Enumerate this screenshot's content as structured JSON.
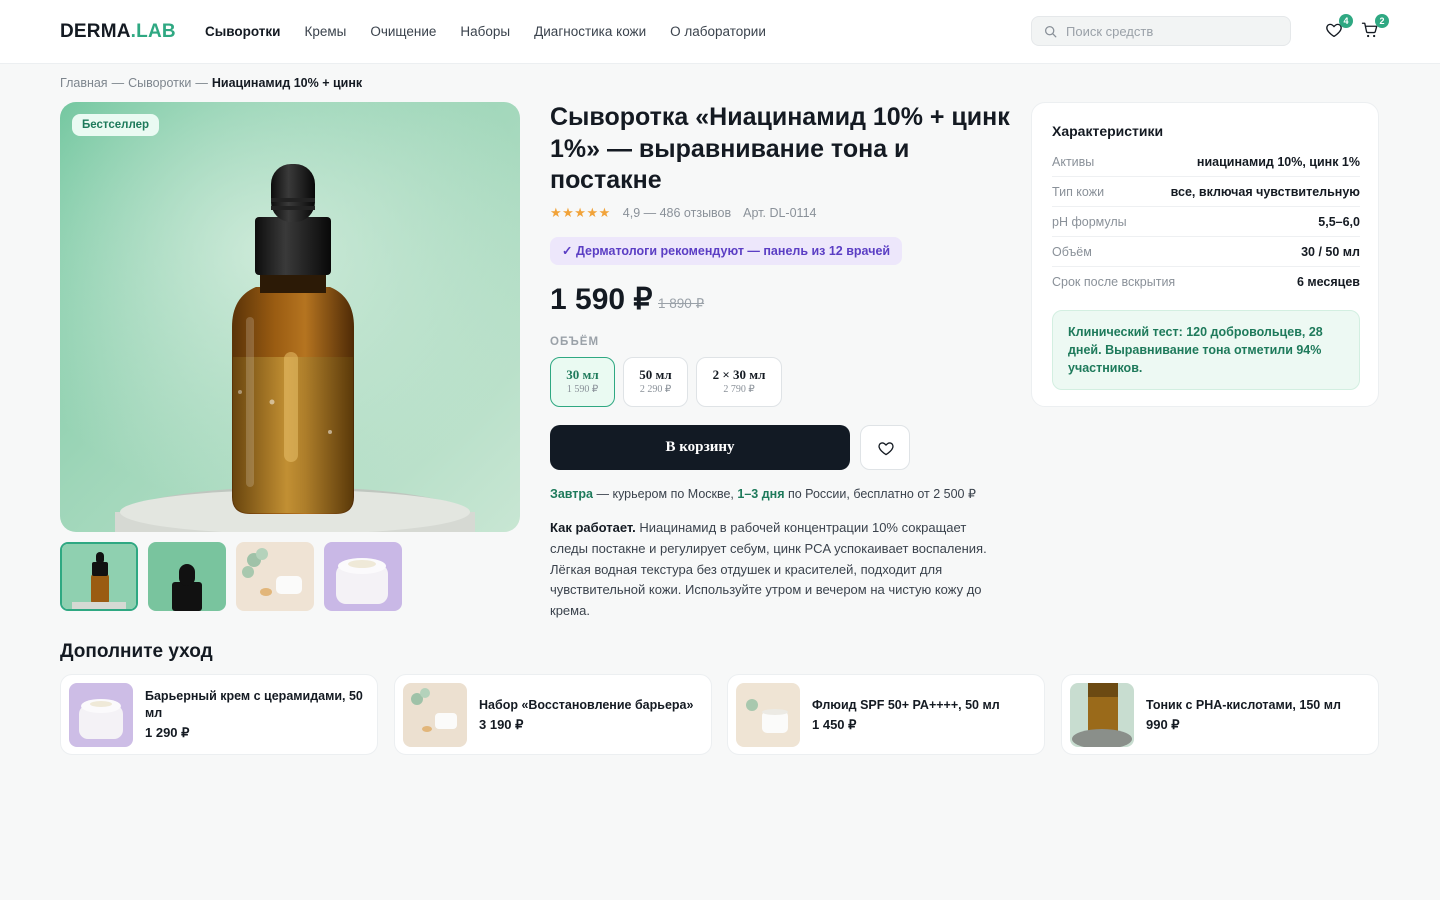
{
  "header": {
    "logo_main": "DERMA",
    "logo_dot": ".",
    "logo_accent": "LAB",
    "nav": [
      "Сыворотки",
      "Кремы",
      "Очищение",
      "Наборы",
      "Диагностика кожи",
      "О лаборатории"
    ],
    "active_nav": "Сыворотки",
    "search_placeholder": "Поиск средств",
    "wishlist_count": "4",
    "cart_count": "2"
  },
  "breadcrumb": {
    "items": [
      "Главная",
      "Сыворотки"
    ],
    "separator": "—",
    "current": "Ниацинамид 10% + цинк"
  },
  "gallery": {
    "badge": "Бестселлер",
    "thumbnails": [
      "dropper-bottle-photo",
      "bottle-top-photo",
      "cream-and-eucalyptus-photo",
      "cream-jar-photo"
    ],
    "selected_thumbnail": 0
  },
  "product": {
    "title": "Сыворотка «Ниацинамид 10% + цинк 1%» — выравнивание тона и постакне",
    "stars": "★★★★★",
    "rating": "4,9 — 486 отзывов",
    "sku": "Арт. DL-0114",
    "recommend_badge": "✓ Дерматологи рекомендуют — панель из 12 врачей",
    "price": "1 590 ₽",
    "old_price": "1 890 ₽",
    "volume_label": "ОБЪЁМ",
    "volumes": [
      {
        "name": "30 мл",
        "price": "1 590 ₽"
      },
      {
        "name": "50 мл",
        "price": "2 290 ₽"
      },
      {
        "name": "2 × 30 мл",
        "price": "2 790 ₽"
      }
    ],
    "selected_volume": 0,
    "cart_button": "В корзину",
    "delivery": {
      "tomorrow": "Завтра",
      "part1": " — курьером по Москве, ",
      "days": "1–3 дня",
      "part2": " по России, бесплатно от 2 500 ₽"
    },
    "description_lead": "Как работает.",
    "description": " Ниацинамид в рабочей концентрации 10% сокращает следы постакне и регулирует себум, цинк PCA успокаивает воспаления. Лёгкая водная текстура без отдушек и красителей, подходит для чувствительной кожи. Используйте утром и вечером на чистую кожу до крема."
  },
  "specs": {
    "title": "Характеристики",
    "rows": [
      {
        "key": "Активы",
        "value": "ниацинамид 10%, цинк 1%"
      },
      {
        "key": "Тип кожи",
        "value": "все, включая чувствительную"
      },
      {
        "key": "pH формулы",
        "value": "5,5–6,0"
      },
      {
        "key": "Объём",
        "value": "30 / 50 мл"
      },
      {
        "key": "Срок после вскрытия",
        "value": "6 месяцев"
      }
    ],
    "clinical": "Клинический тест: 120 добровольцев, 28 дней. Выравнивание тона отметили 94% участников."
  },
  "recommendations": {
    "title": "Дополните уход",
    "items": [
      {
        "name": "Барьерный крем с церамидами, 50 мл",
        "price": "1 290 ₽"
      },
      {
        "name": "Набор «Восстановление барьера»",
        "price": "3 190 ₽"
      },
      {
        "name": "Флюид SPF 50+ PA++++, 50 мл",
        "price": "1 450 ₽"
      },
      {
        "name": "Тоник с PHA-кислотами, 150 мл",
        "price": "990 ₽"
      }
    ]
  },
  "colors": {
    "accent": "#2fa882",
    "accent_dark": "#1e7a5b",
    "dark_button": "#121a24",
    "star": "#f1a33a",
    "recommend_bg": "#ede7fb",
    "recommend_text": "#5b3ec4"
  }
}
